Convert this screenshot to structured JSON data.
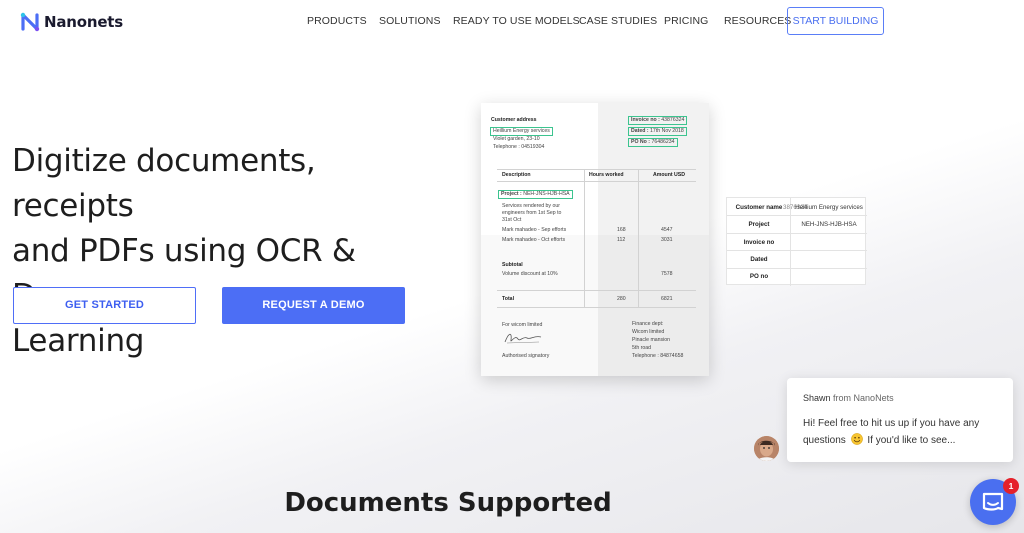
{
  "brand": {
    "name": "Nanonets",
    "logo_icon": "nanonets-logo-icon",
    "accent": "#4c6ef5"
  },
  "nav": {
    "items": [
      "PRODUCTS",
      "SOLUTIONS",
      "READY TO USE MODELS",
      "CASE STUDIES",
      "PRICING",
      "RESOURCES"
    ],
    "cta": "START BUILDING"
  },
  "hero": {
    "title_lines": [
      "Digitize documents, receipts",
      "and PDFs using OCR & Deep",
      "Learning"
    ],
    "primary_button": "GET STARTED",
    "secondary_button": "REQUEST A DEMO"
  },
  "invoice": {
    "customer_address_label": "Customer address",
    "customer_name": "Heillium Energy services",
    "address_line": "Violet garden, 23-10",
    "telephone": "Telephone : 04519304",
    "invoice_no_label": "Invoice no :",
    "invoice_no": "43876324",
    "dated_label": "Dated :",
    "dated": "17th Nov 2018",
    "po_label": "PO No :",
    "po": "76486234",
    "col_description": "Description",
    "col_hours": "Hours worked",
    "col_amount": "Amount USD",
    "project_label": "Project :",
    "project": "NEH-JNS-HJB-HSA",
    "services_lines": [
      "Services rendered by our",
      "engineers from 1st Sep to",
      "31st Oct"
    ],
    "row1": {
      "desc": "Mark mahadeo - Sep efforts",
      "hours": "168",
      "amount": "4547"
    },
    "row2": {
      "desc": "Mark mahadeo - Oct efforts",
      "hours": "112",
      "amount": "3031"
    },
    "subtotal": "Subtotal",
    "volume": "Volume discount at 10%",
    "volume_amount": "7578",
    "total": "Total",
    "total_hours": "280",
    "total_amount": "6821",
    "for_company": "For wicom limited",
    "signatory": "Authorised signatory",
    "finance_lines": [
      "Finance dept:",
      "Wicom limited",
      "Pinacle mansion",
      "5th road",
      "Telephone : 84874658"
    ]
  },
  "extracted": {
    "rows": [
      {
        "key": "Customer name",
        "value": "Heillium Energy services",
        "overlap": "3876324"
      },
      {
        "key": "Project",
        "value": "NEH-JNS-HJB-HSA"
      },
      {
        "key": "Invoice no",
        "value": ""
      },
      {
        "key": "Dated",
        "value": ""
      },
      {
        "key": "PO no",
        "value": ""
      }
    ]
  },
  "section": {
    "title": "Documents Supported"
  },
  "chat": {
    "sender": "Shawn",
    "from_text": "from NanoNets",
    "message_line1": "Hi! Feel free to hit us up if you have any",
    "message_line2a": "questions",
    "message_line2b": "If you'd like to see...",
    "emoji": "smile-emoji",
    "avatar": "agent-avatar",
    "launcher_icon": "chat-bubble-icon",
    "badge_count": "1"
  }
}
